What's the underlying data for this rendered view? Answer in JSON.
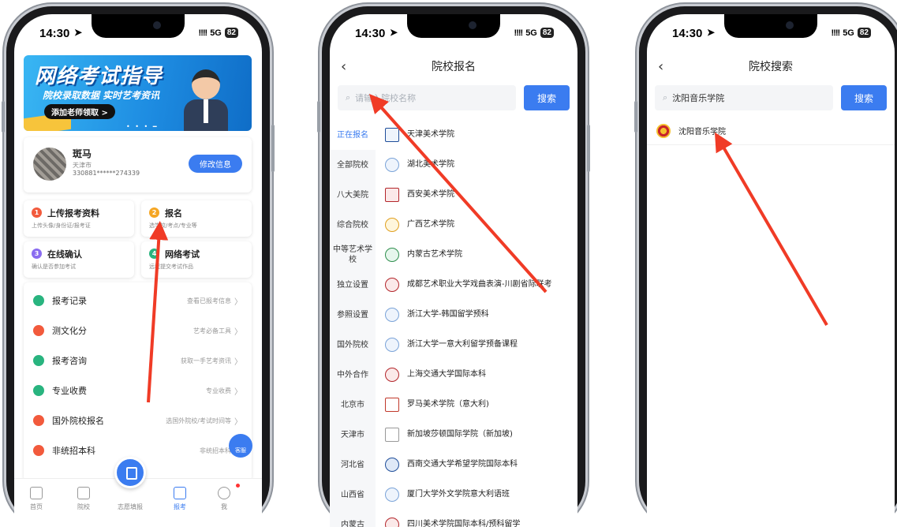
{
  "status": {
    "time": "14:30",
    "signal": "!!!!",
    "network": "5G",
    "battery": "82"
  },
  "phone1": {
    "banner": {
      "title": "网络考试指导",
      "subtitle": "院校录取数据 实时艺考资讯",
      "button": "添加老师领取 >"
    },
    "user": {
      "name": "斑马",
      "city": "天津市",
      "id": "330881******274339",
      "edit_label": "修改信息"
    },
    "steps": [
      {
        "num": "1",
        "title": "上传报考资料",
        "sub": "上传头像/身份证/报考证",
        "color": "#f25a3c"
      },
      {
        "num": "2",
        "title": "报名",
        "sub": "选学校/考点/专业等",
        "color": "#f5a623"
      },
      {
        "num": "3",
        "title": "在线确认",
        "sub": "确认是否参加考试",
        "color": "#8a6cf0"
      },
      {
        "num": "4",
        "title": "网络考试",
        "sub": "远程提交考试作品",
        "color": "#29b47f"
      }
    ],
    "menu": [
      {
        "label": "报考记录",
        "right": "查看已报考信息",
        "color": "#29b47f"
      },
      {
        "label": "测文化分",
        "right": "艺考必备工具",
        "color": "#f25a3c"
      },
      {
        "label": "报考咨询",
        "right": "获取一手艺考资讯",
        "color": "#29b47f"
      },
      {
        "label": "专业收费",
        "right": "专业收费",
        "color": "#29b47f"
      },
      {
        "label": "国外院校报名",
        "right": "选国外院校/考试时间等",
        "color": "#f25a3c"
      },
      {
        "label": "非统招本科",
        "right": "非统招本科",
        "color": "#f25a3c"
      }
    ],
    "service": "客服",
    "tabs": [
      {
        "label": "首页"
      },
      {
        "label": "院校"
      },
      {
        "label": "志愿填报"
      },
      {
        "label": "报考"
      },
      {
        "label": "我"
      }
    ]
  },
  "phone2": {
    "title": "院校报名",
    "back": "‹",
    "search_placeholder": "请输入院校名称",
    "search_button": "搜索",
    "categories": [
      "正在报名",
      "全部院校",
      "八大美院",
      "综合院校",
      "中等艺术学校",
      "独立设置",
      "参照设置",
      "国外院校",
      "中外合作",
      "北京市",
      "天津市",
      "河北省",
      "山西省",
      "内蒙古"
    ],
    "schools": [
      "天津美术学院",
      "湖北美术学院",
      "西安美术学院",
      "广西艺术学院",
      "内蒙古艺术学院",
      "成都艺术职业大学戏曲表演-川剧省际联考",
      "浙江大学-韩国留学预科",
      "浙江大学一意大利留学预备课程",
      "上海交通大学国际本科",
      "罗马美术学院（意大利)",
      "新加坡莎顿国际学院（新加坡)",
      "西南交通大学希望学院国际本科",
      "厦门大学外文学院意大利语班",
      "四川美术学院国际本科/预科留学"
    ]
  },
  "phone3": {
    "title": "院校搜索",
    "back": "‹",
    "search_value": "沈阳音乐学院",
    "search_button": "搜索",
    "result": "沈阳音乐学院"
  },
  "colors": {
    "accent": "#3b7cf0",
    "arrow": "#f03b26"
  }
}
